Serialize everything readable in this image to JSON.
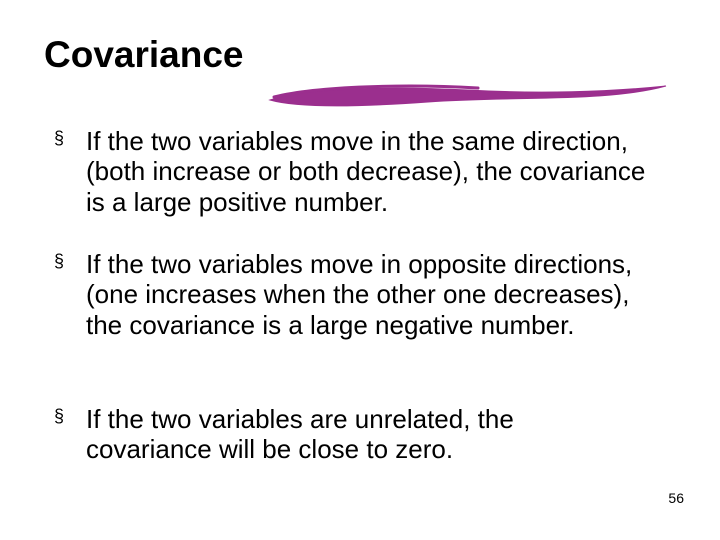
{
  "slide": {
    "title": "Covariance",
    "bullets": [
      "If the two variables move in the same direction, (both increase or both decrease), the covariance is a large positive number.",
      "If the two variables move in opposite directions, (one increases when the other one decreases), the covariance is a large negative number.",
      "If the two variables are unrelated, the covariance will be close to zero."
    ],
    "page_number": "56",
    "accent_color": "#9b2f8e"
  }
}
